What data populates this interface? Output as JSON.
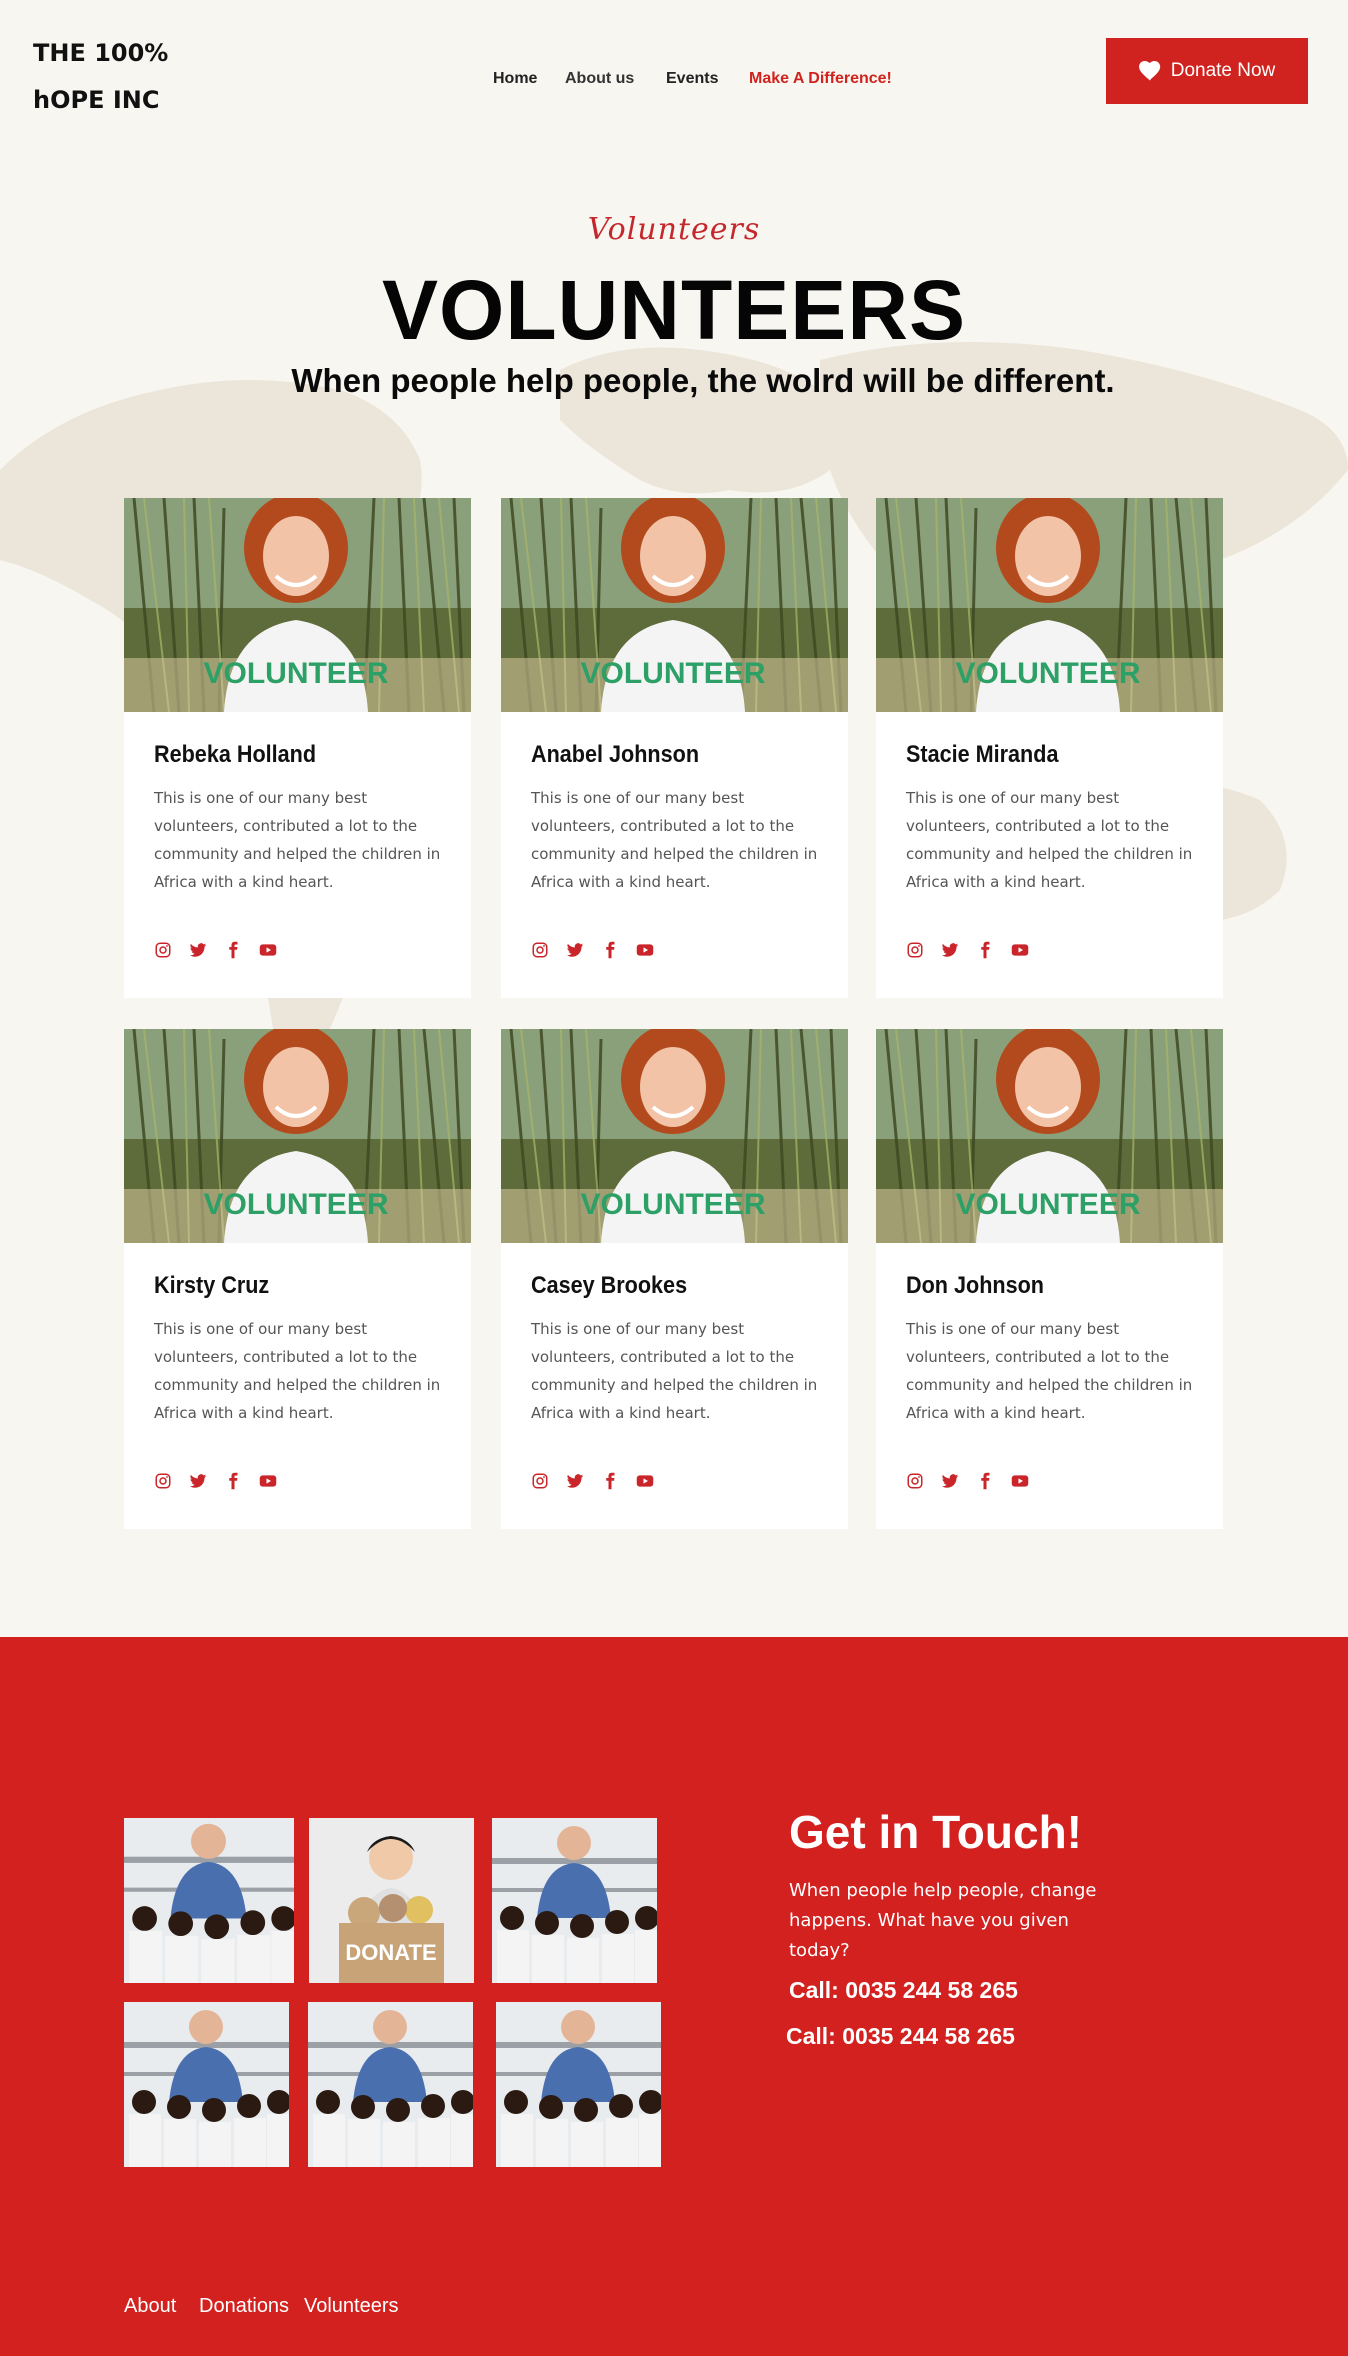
{
  "logo": {
    "line1": "THE 100%",
    "line2": "hOPE INC"
  },
  "nav": {
    "items": [
      {
        "label": "Home"
      },
      {
        "label": "About us"
      },
      {
        "label": "Events"
      },
      {
        "label": "Make A Difference!"
      }
    ]
  },
  "donate_button": {
    "label": "Donate Now",
    "icon": "heart-icon"
  },
  "hero": {
    "script_title": "Volunteers",
    "title": "VOLUNTEERS",
    "subtitle": "When people help people, the wolrd will be different."
  },
  "volunteers": [
    {
      "name": "Rebeka Holland",
      "description": "This is one of our many best volunteers, contributed a lot to the community and helped the children in Africa with a kind heart."
    },
    {
      "name": "Anabel Johnson",
      "description": "This is one of our many best volunteers, contributed a lot to the community and helped the children in Africa with a kind heart."
    },
    {
      "name": "Stacie Miranda",
      "description": "This is one of our many best volunteers, contributed a lot to the community and helped the children in Africa with a kind heart."
    },
    {
      "name": "Kirsty Cruz",
      "description": "This is one of our many best volunteers, contributed a lot to the community and helped the children in Africa with a kind heart."
    },
    {
      "name": "Casey Brookes",
      "description": "This is one of our many best volunteers, contributed a lot to the community and helped the children in Africa with a kind heart."
    },
    {
      "name": "Don Johnson",
      "description": "This is one of our many best volunteers, contributed a lot to the community and helped the children in Africa with a kind heart."
    }
  ],
  "photo_text": {
    "shirt": "VOLUNTEER",
    "box": "DONATE"
  },
  "social_icons": [
    "instagram-icon",
    "twitter-icon",
    "facebook-icon",
    "youtube-icon"
  ],
  "contact": {
    "title": "Get in Touch!",
    "text": "When people help people, change happens. What have you given today?",
    "call_1": "Call: 0035 244 58 265",
    "call_2": "Call: 0035 244 58 265"
  },
  "footer_links": [
    {
      "label": "About"
    },
    {
      "label": "Donations"
    },
    {
      "label": "Volunteers"
    }
  ],
  "colors": {
    "accent": "#d0231f",
    "background": "#f8f6f0",
    "footer": "#d2211f"
  }
}
